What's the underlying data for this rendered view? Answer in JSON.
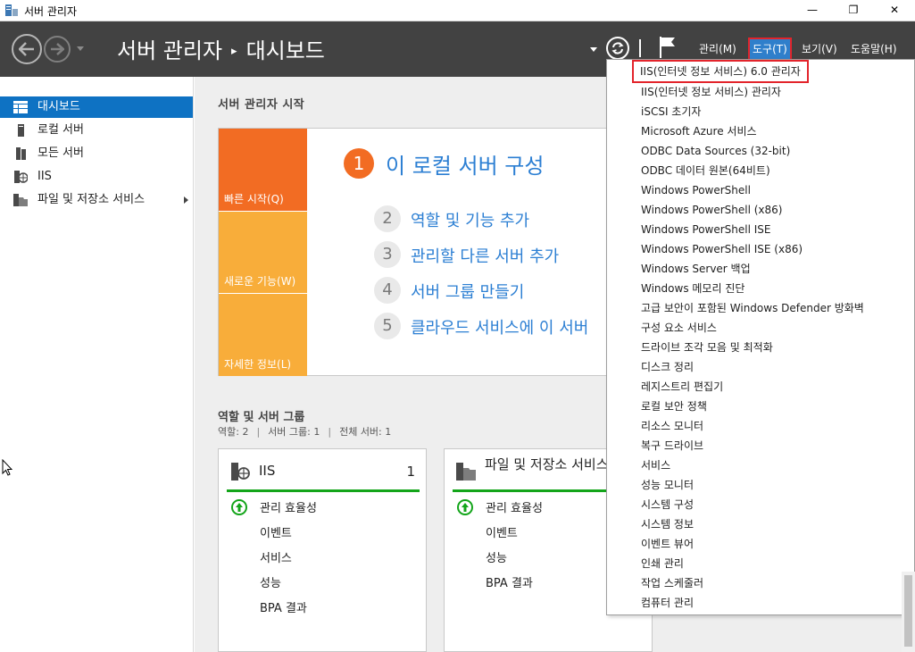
{
  "window": {
    "title": "서버 관리자",
    "controls": {
      "minimize": "—",
      "maximize": "❐",
      "close": "✕"
    }
  },
  "header": {
    "breadcrumb_root": "서버 관리자",
    "breadcrumb_sep": "▸",
    "breadcrumb_current": "대시보드",
    "menus": {
      "manage": "관리(M)",
      "tools": "도구(T)",
      "view": "보기(V)",
      "help": "도움말(H)"
    }
  },
  "sidebar": {
    "items": [
      {
        "label": "대시보드",
        "icon": "dashboard-icon",
        "active": true
      },
      {
        "label": "로컬 서버",
        "icon": "server-icon",
        "active": false
      },
      {
        "label": "모든 서버",
        "icon": "servers-icon",
        "active": false
      },
      {
        "label": "IIS",
        "icon": "iis-icon",
        "active": false
      },
      {
        "label": "파일 및 저장소 서비스",
        "icon": "file-storage-icon",
        "active": false,
        "has_submenu": true
      }
    ]
  },
  "main": {
    "welcome_title": "서버 관리자 시작",
    "tiles": [
      {
        "label": "빠른 시작(Q)"
      },
      {
        "label": "새로운 기능(W)"
      },
      {
        "label": "자세한 정보(L)"
      }
    ],
    "steps": [
      {
        "num": "1",
        "label": "이 로컬 서버 구성"
      },
      {
        "num": "2",
        "label": "역할 및 기능 추가"
      },
      {
        "num": "3",
        "label": "관리할 다른 서버 추가"
      },
      {
        "num": "4",
        "label": "서버 그룹 만들기"
      },
      {
        "num": "5",
        "label": "클라우드 서비스에 이 서버"
      }
    ],
    "roles": {
      "title": "역할 및 서버 그룹",
      "summary": {
        "roles": "역할: 2",
        "groups": "서버 그룹: 1",
        "servers": "전체 서버: 1",
        "sep": "|"
      },
      "cards": [
        {
          "title": "IIS",
          "count": "1",
          "rows": [
            "관리 효율성",
            "이벤트",
            "서비스",
            "성능",
            "BPA 결과"
          ]
        },
        {
          "title": "파일 및 저장소 서비스",
          "count": "",
          "rows": [
            "관리 효율성",
            "이벤트",
            "성능",
            "BPA 결과"
          ]
        }
      ]
    }
  },
  "tools_menu": {
    "items": [
      "IIS(인터넷 정보 서비스) 6.0 관리자",
      "IIS(인터넷 정보 서비스) 관리자",
      "iSCSI 초기자",
      "Microsoft Azure 서비스",
      "ODBC Data Sources (32-bit)",
      "ODBC 데이터 원본(64비트)",
      "Windows PowerShell",
      "Windows PowerShell (x86)",
      "Windows PowerShell ISE",
      "Windows PowerShell ISE (x86)",
      "Windows Server 백업",
      "Windows 메모리 진단",
      "고급 보안이 포함된 Windows Defender 방화벽",
      "구성 요소 서비스",
      "드라이브 조각 모음 및 최적화",
      "디스크 정리",
      "레지스트리 편집기",
      "로컬 보안 정책",
      "리소스 모니터",
      "복구 드라이브",
      "서비스",
      "성능 모니터",
      "시스템 구성",
      "시스템 정보",
      "이벤트 뷰어",
      "인쇄 관리",
      "작업 스케줄러",
      "컴퓨터 관리"
    ]
  },
  "colors": {
    "header_bg": "#424242",
    "accent_blue": "#0e72c3",
    "link_blue": "#2c7fd3",
    "tile_orange": "#f26c23",
    "tile_amber": "#f8ad3a",
    "status_green": "#13a51a",
    "highlight_red": "#e3242b"
  }
}
